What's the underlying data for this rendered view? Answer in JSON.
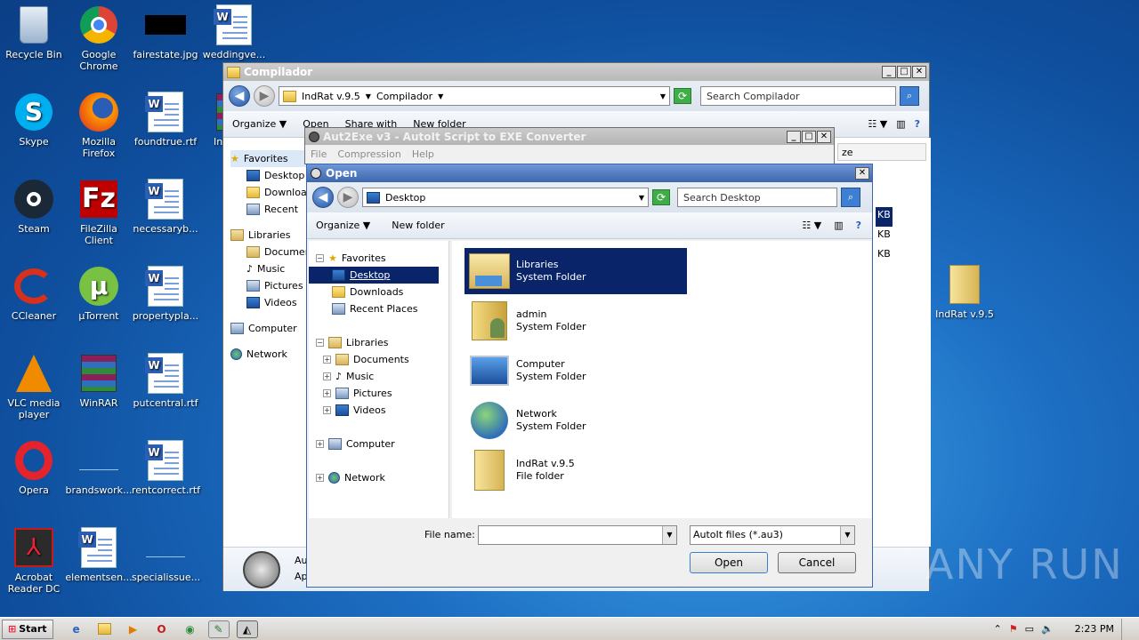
{
  "desktop_icons": [
    {
      "label": "Recycle Bin",
      "icon": "recycle-bin-icon"
    },
    {
      "label": "Google Chrome",
      "icon": "chrome-icon"
    },
    {
      "label": "fairestate.jpg",
      "icon": "image-file-icon"
    },
    {
      "label": "weddingve...",
      "icon": "word-document-icon"
    },
    {
      "label": "Skype",
      "icon": "skype-icon"
    },
    {
      "label": "Mozilla Firefox",
      "icon": "firefox-icon"
    },
    {
      "label": "foundtrue.rtf",
      "icon": "word-document-icon"
    },
    {
      "label": "Inde Rat",
      "icon": "winrar-icon"
    },
    {
      "label": "Steam",
      "icon": "steam-icon"
    },
    {
      "label": "FileZilla Client",
      "icon": "filezilla-icon"
    },
    {
      "label": "necessaryb...",
      "icon": "word-document-icon"
    },
    {
      "label": "CCleaner",
      "icon": "ccleaner-icon"
    },
    {
      "label": "µTorrent",
      "icon": "utorrent-icon"
    },
    {
      "label": "propertypla...",
      "icon": "word-document-icon"
    },
    {
      "label": "VLC media player",
      "icon": "vlc-icon"
    },
    {
      "label": "WinRAR",
      "icon": "winrar-icon"
    },
    {
      "label": "putcentral.rtf",
      "icon": "word-document-icon"
    },
    {
      "label": "Opera",
      "icon": "opera-icon"
    },
    {
      "label": "brandswork...",
      "icon": "blank-file-icon"
    },
    {
      "label": "rentcorrect.rtf",
      "icon": "word-document-icon"
    },
    {
      "label": "Acrobat Reader DC",
      "icon": "acrobat-icon"
    },
    {
      "label": "elementsen...",
      "icon": "word-document-icon"
    },
    {
      "label": "specialissue...",
      "icon": "blank-file-icon"
    },
    {
      "label": "IndRat v.9.5",
      "icon": "folder-icon"
    }
  ],
  "explorer": {
    "title": "Compilador",
    "breadcrumb": [
      "IndRat v.9.5",
      "Compilador"
    ],
    "search_placeholder": "Search Compilador",
    "cmd": {
      "organize": "Organize",
      "open": "Open",
      "share": "Share with",
      "new_folder": "New folder"
    },
    "sidebar": [
      "Favorites",
      "Desktop",
      "Downloads",
      "Recent",
      "Libraries",
      "Documents",
      "Music",
      "Pictures",
      "Videos",
      "Computer",
      "Network"
    ],
    "size_column": "ze",
    "size_cells": [
      "KB",
      "KB",
      "KB"
    ],
    "details": {
      "name": "Au",
      "type": "Ap"
    }
  },
  "aut2exe": {
    "title": "Aut2Exe v3 - AutoIt Script to EXE Converter",
    "menu": [
      "File",
      "Compression",
      "Help"
    ]
  },
  "open_dialog": {
    "title": "Open",
    "location": "Desktop",
    "search_placeholder": "Search Desktop",
    "organize": "Organize",
    "new_folder": "New folder",
    "tree": {
      "favorites": "Favorites",
      "favorites_items": [
        "Desktop",
        "Downloads",
        "Recent Places"
      ],
      "libraries": "Libraries",
      "libraries_items": [
        "Documents",
        "Music",
        "Pictures",
        "Videos"
      ],
      "computer": "Computer",
      "network": "Network"
    },
    "items": [
      {
        "name": "Libraries",
        "type": "System Folder",
        "icon": "libraries-icon"
      },
      {
        "name": "admin",
        "type": "System Folder",
        "icon": "user-folder-icon"
      },
      {
        "name": "Computer",
        "type": "System Folder",
        "icon": "computer-icon"
      },
      {
        "name": "Network",
        "type": "System Folder",
        "icon": "network-icon"
      },
      {
        "name": "IndRat v.9.5",
        "type": "File folder",
        "icon": "folder-icon"
      }
    ],
    "file_name_label": "File name:",
    "file_name_value": "",
    "file_type": "AutoIt files (*.au3)",
    "open_btn": "Open",
    "cancel_btn": "Cancel"
  },
  "taskbar": {
    "start": "Start",
    "clock": "2:23 PM"
  },
  "watermark": "ANY RUN",
  "colors": {
    "selection": "#0a246a",
    "title_active": "#3c67ad"
  }
}
